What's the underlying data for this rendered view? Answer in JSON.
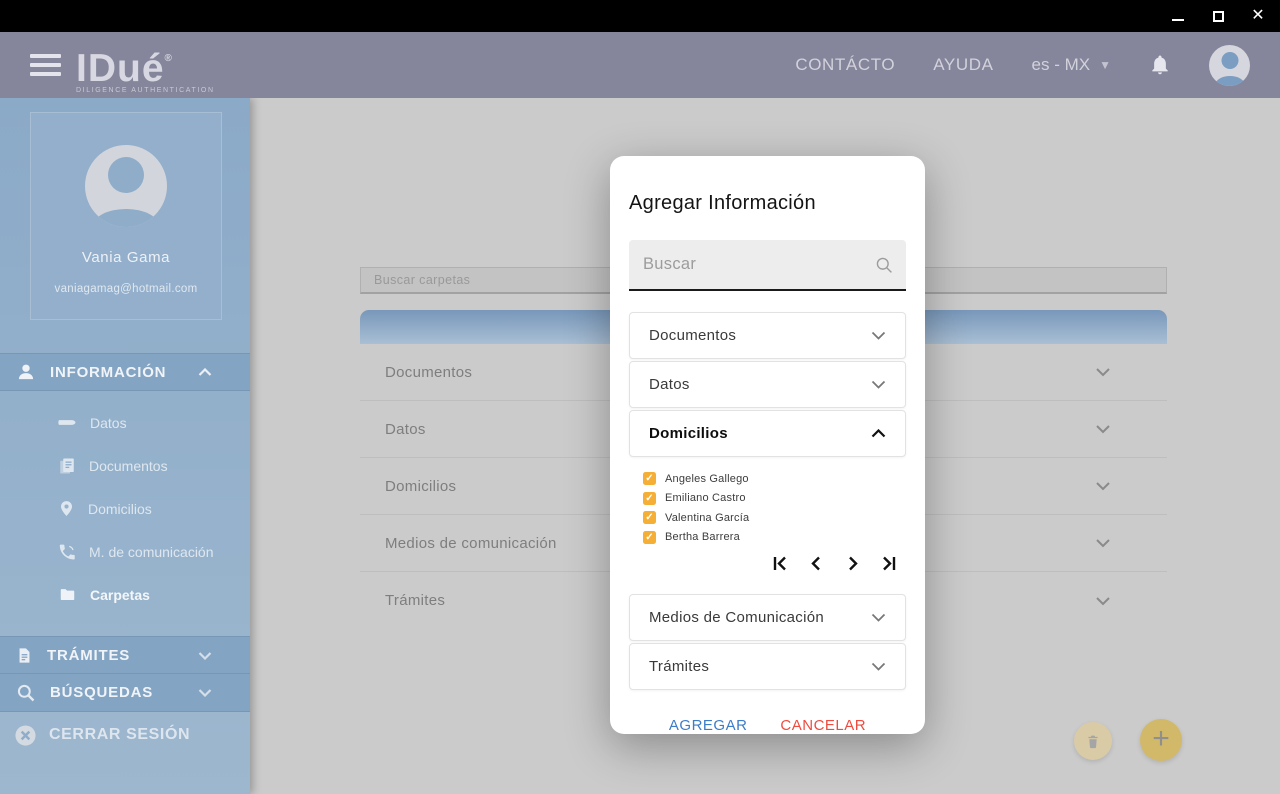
{
  "colors": {
    "header-gray": "#85859B",
    "sidebar-blue-top": "#8BAAC8",
    "sidebar-blue-bottom": "#9DB7CE",
    "accent-blue": "#3D7CC9",
    "accent-red": "#F04B3E",
    "checkbox-orange": "#F5AF36",
    "fab-yellow": "#D2B969"
  },
  "icons": {
    "language_caret": "▼",
    "close": "✕",
    "plus": "+",
    "check": "✓"
  },
  "header": {
    "logo": "IDué",
    "logo_mark": "®",
    "logo_sub": "DILIGENCE AUTHENTICATION",
    "contact_label": "CONTÁCTO",
    "help_label": "AYUDA",
    "language": "es - MX"
  },
  "sidebar": {
    "profile": {
      "name": "Vania Gama",
      "email": "vaniagamag@hotmail.com"
    },
    "info_label": "INFORMACIÓN",
    "info_items": [
      {
        "label": "Datos"
      },
      {
        "label": "Documentos"
      },
      {
        "label": "Domicilios"
      },
      {
        "label": "M. de comunicación"
      },
      {
        "label": "Carpetas"
      }
    ],
    "tramites_label": "TRÁMITES",
    "busquedas_label": "BÚSQUEDAS",
    "logout_label": "CERRAR SESIÓN"
  },
  "content": {
    "search_placeholder": "Buscar carpetas",
    "rows": [
      {
        "label": "Documentos"
      },
      {
        "label": "Datos"
      },
      {
        "label": "Domicilios"
      },
      {
        "label": "Medios de comunicación"
      },
      {
        "label": "Trámites"
      }
    ]
  },
  "modal": {
    "title": "Agregar Información",
    "search_placeholder": "Buscar",
    "accordions": [
      {
        "label": "Documentos",
        "expanded": false
      },
      {
        "label": "Datos",
        "expanded": false
      },
      {
        "label": "Domicilios",
        "expanded": true
      },
      {
        "label": "Medios de Comunicación",
        "expanded": false
      },
      {
        "label": "Trámites",
        "expanded": false
      }
    ],
    "domicilios_items": [
      {
        "label": "Angeles Gallego",
        "checked": true
      },
      {
        "label": "Emiliano Castro",
        "checked": true
      },
      {
        "label": "Valentina García",
        "checked": true
      },
      {
        "label": "Bertha Barrera",
        "checked": true
      }
    ],
    "confirm_label": "AGREGAR",
    "cancel_label": "CANCELAR"
  }
}
